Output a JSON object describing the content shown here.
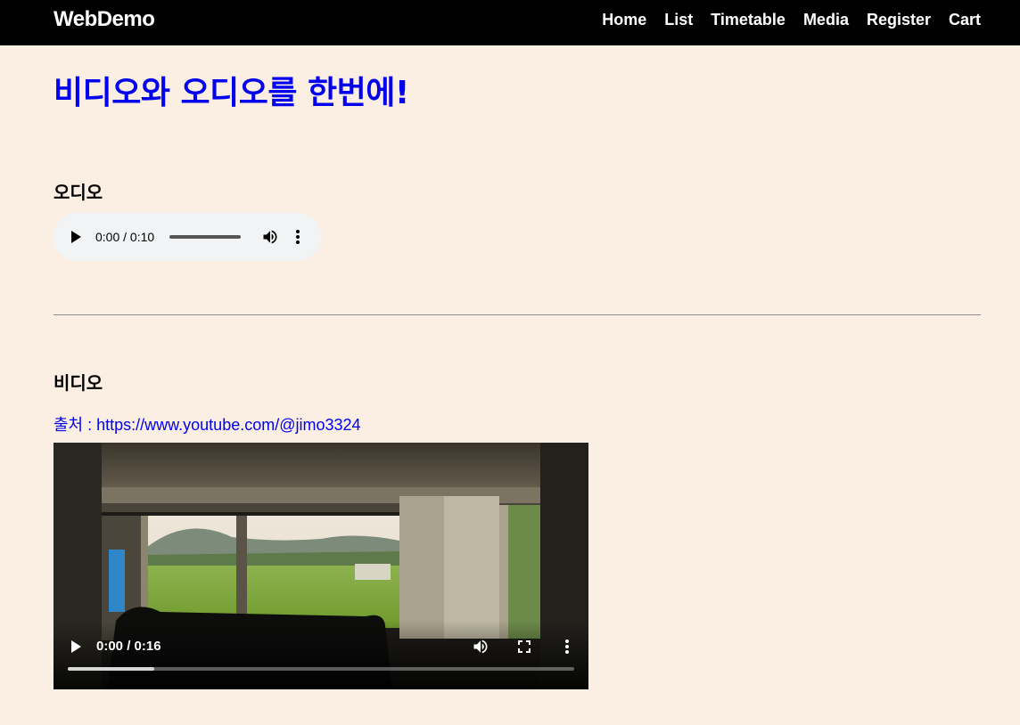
{
  "navbar": {
    "brand": "WebDemo",
    "links": [
      "Home",
      "List",
      "Timetable",
      "Media",
      "Register",
      "Cart"
    ]
  },
  "page_title": "비디오와 오디오를 한번에!",
  "audio_section": {
    "heading": "오디오",
    "player": {
      "time": "0:00 / 0:10",
      "progress": 0
    }
  },
  "video_section": {
    "heading": "비디오",
    "source_prefix": "출처 : ",
    "source_url": "https://www.youtube.com/@jimo3324",
    "player": {
      "time": "0:00 / 0:16",
      "progress": 0,
      "buffered": 0.17
    }
  },
  "colors": {
    "background": "#fbefe4",
    "navbar": "#000000",
    "title": "#0000ee",
    "link": "#0000ee"
  },
  "icons": [
    "play-icon",
    "volume-icon",
    "more-vert-icon",
    "fullscreen-icon"
  ]
}
